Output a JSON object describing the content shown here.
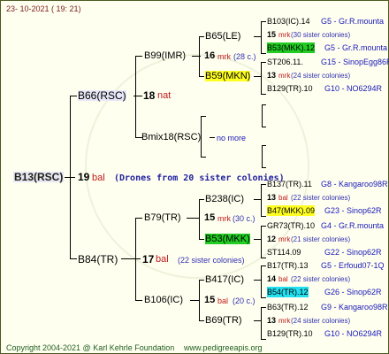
{
  "header": "23- 10-2021 ( 19: 21)",
  "footer": {
    "copyright": "Copyright 2004-2021 @ Karl Kehrle Foundation",
    "site": "www.pedigreeapis.org"
  },
  "queen": "B13(RSC)",
  "queen_num": "19",
  "queen_race": "bal",
  "drones_note": "(Drones from 20 sister colonies)",
  "dam": "B66(RSC)",
  "dam_num": "18",
  "dam_race": "nat",
  "dam_dam": "B99(IMR)",
  "dd_num": "16",
  "dd_race": "mrk",
  "dd_note": "(28 c.)",
  "dam_sire": "Bmix18(RSC)",
  "ds_note": "no more",
  "ddd": "B65(LE)",
  "dds": "B59(MKN)",
  "sire": "B84(TR)",
  "sire_num": "17",
  "sire_race": "bal",
  "sire_note": "(22 sister colonies)",
  "sire_dam": "B79(TR)",
  "sd_num": "15",
  "sd_race": "mrk",
  "sd_note": "(30 c.)",
  "sire_sire": "B106(IC)",
  "ss_num": "15",
  "ss_race": "bal",
  "ss_note": "(20 c.)",
  "sdd": "B238(IC)",
  "sds": "B53(MKK)",
  "ssd": "B417(IC)",
  "sss": "B69(TR)",
  "g4": [
    {
      "top": "B103(IC).14",
      "topnote": "G5 - Gr.R.mounta",
      "num": "15",
      "race": "mrk",
      "sis": "(30 sister colonies)",
      "bot": "B53(MKK).12",
      "botnote": "G5 - Gr.R.mounta",
      "bothl": "green"
    },
    {
      "top": "ST206.11.",
      "topnote": "G15 - SinopEgg86R",
      "num": "13",
      "race": "mrk",
      "sis": "(24 sister colonies)",
      "bot": "B129(TR).10",
      "botnote": "G10 - NO6294R",
      "bothl": ""
    },
    {
      "top": "B137(TR).11",
      "topnote": "G8 - Kangaroo98R",
      "num": "13",
      "race": "bal",
      "sis": "(22 sister colonies)",
      "bot": "B47(MKK).09",
      "botnote": "G23 - Sinop62R",
      "bothl": "yellow"
    },
    {
      "top": "GR73(TR).10",
      "topnote": "G4 - Gr.R.mounta",
      "num": "12",
      "race": "mrk",
      "sis": "(21 sister colonies)",
      "bot": "ST114.09",
      "botnote": "G22 - Sinop62R",
      "bothl": ""
    },
    {
      "top": "B17(TR).13",
      "topnote": "G5 - Erfoud07-1Q",
      "num": "14",
      "race": "bal",
      "sis": "(22 sister colonies)",
      "bot": "B54(TR).12",
      "botnote": "G26 - Sinop62R",
      "bothl": "cyan"
    },
    {
      "top": "B63(TR).12",
      "topnote": "G9 - Kangaroo98R",
      "num": "13",
      "race": "mrk",
      "sis": "(24 sister colonies)",
      "bot": "B129(TR).10",
      "botnote": "G10 - NO6294R",
      "bothl": ""
    }
  ]
}
